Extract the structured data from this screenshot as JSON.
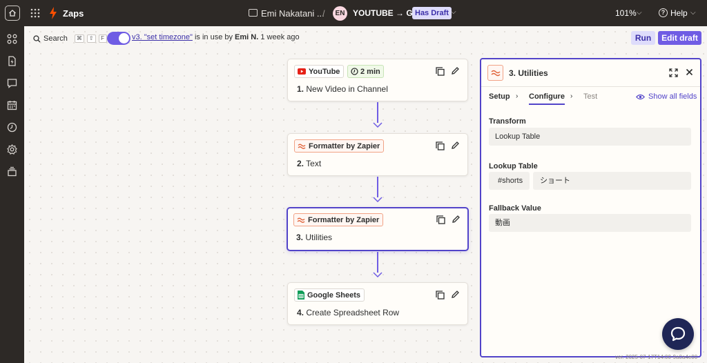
{
  "topbar": {
    "app_name": "Zaps",
    "folder_name": "Emi Nakatani ...",
    "separator": "/",
    "owner_initials": "EN",
    "zap_name": "YOUTUBE → GS",
    "draft_badge": "Has Draft",
    "zoom": "101%",
    "help_label": "Help"
  },
  "statusbar": {
    "search_label": "Search",
    "shortcut_keys": [
      "⌘",
      "⇧",
      "F"
    ],
    "version_link": "v3. \"set timezone\"",
    "status_mid": " is in use by ",
    "user": "Emi N.",
    "time": " 1 week ago",
    "run_label": "Run",
    "edit_label": "Edit draft"
  },
  "steps": [
    {
      "app": "YouTube",
      "time_badge": "2 min",
      "number": "1.",
      "title": "New Video in Channel"
    },
    {
      "app": "Formatter by Zapier",
      "number": "2.",
      "title": "Text"
    },
    {
      "app": "Formatter by Zapier",
      "number": "3.",
      "title": "Utilities"
    },
    {
      "app": "Google Sheets",
      "number": "4.",
      "title": "Create Spreadsheet Row"
    }
  ],
  "panel": {
    "title": "3. Utilities",
    "tabs": {
      "setup": "Setup",
      "configure": "Configure",
      "test": "Test"
    },
    "show_all": "Show all fields",
    "transform_label": "Transform",
    "transform_value": "Lookup Table",
    "lookup_label": "Lookup Table",
    "lookup_key": "#shorts",
    "lookup_value": "ショート",
    "fallback_label": "Fallback Value",
    "fallback_value": "動画"
  },
  "footer": {
    "version": "ver. 2025-07-17T14:00-9a0a4e00"
  },
  "colors": {
    "accent": "#5143c9",
    "accent_light": "#dedcfb",
    "topbar_bg": "#2d2926",
    "canvas_bg": "#f7f5f2",
    "formatter_orange": "#f1a285",
    "youtube_red": "#e62117",
    "sheets_green": "#0f9d58"
  }
}
